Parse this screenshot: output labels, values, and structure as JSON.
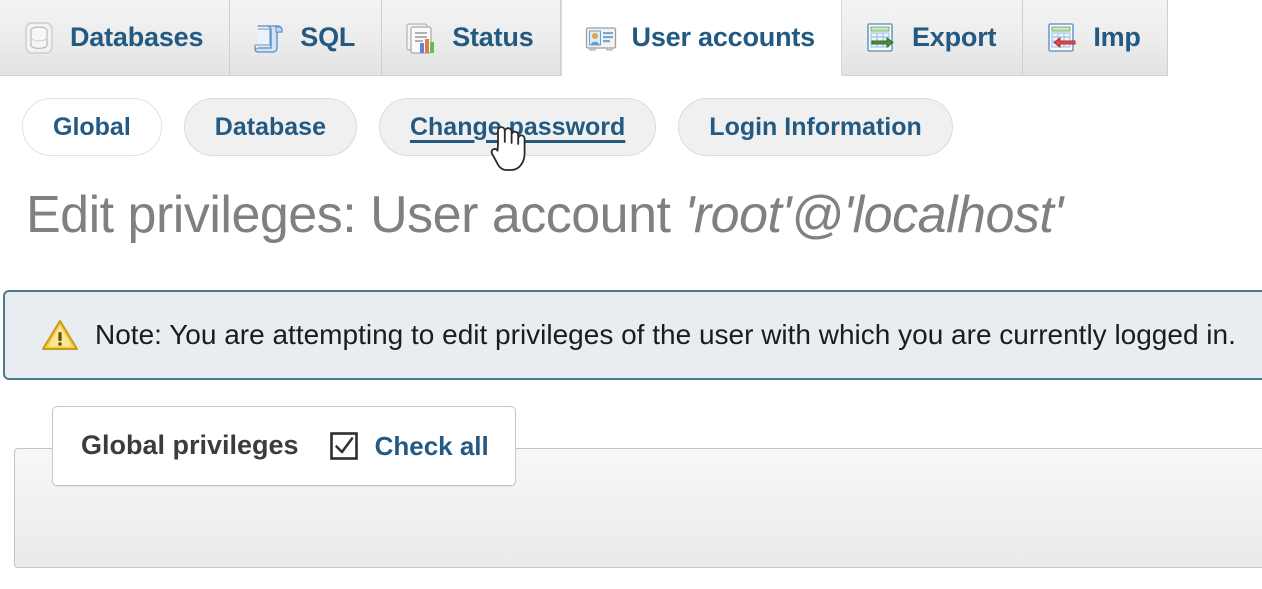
{
  "navbar": {
    "tabs": [
      {
        "label": "Databases",
        "icon": "database-icon",
        "active": false
      },
      {
        "label": "SQL",
        "icon": "sql-scroll-icon",
        "active": false
      },
      {
        "label": "Status",
        "icon": "status-chart-icon",
        "active": false
      },
      {
        "label": "User accounts",
        "icon": "user-card-icon",
        "active": true
      },
      {
        "label": "Export",
        "icon": "export-icon",
        "active": false
      },
      {
        "label": "Imp",
        "icon": "import-icon",
        "active": false
      }
    ]
  },
  "subnav": {
    "pills": [
      {
        "label": "Global",
        "state": "active"
      },
      {
        "label": "Database",
        "state": "normal"
      },
      {
        "label": "Change password",
        "state": "hovered"
      },
      {
        "label": "Login Information",
        "state": "normal"
      }
    ]
  },
  "page": {
    "title_prefix": "Edit privileges: User account ",
    "title_account": "'root'@'localhost'"
  },
  "notice": {
    "icon": "warning-triangle-icon",
    "text": "Note: You are attempting to edit privileges of the user with which you are currently logged in."
  },
  "fieldset": {
    "legend_title": "Global privileges",
    "check_all_label": "Check all",
    "check_all_checked": true,
    "checkbox_icon": "checked-checkbox-icon"
  },
  "cursor": {
    "icon": "pointing-hand-cursor"
  },
  "colors": {
    "tab_link": "#235a81",
    "title_gray": "#808080",
    "notice_bg": "#e7edf1",
    "notice_border": "#4b7c8e",
    "warning_yellow": "#f2c230"
  }
}
